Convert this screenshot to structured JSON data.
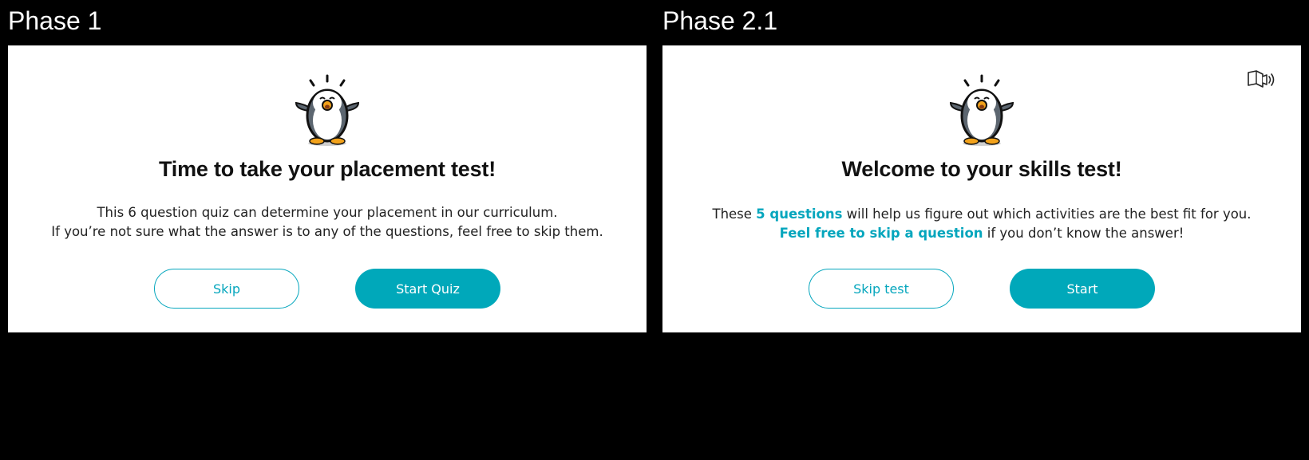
{
  "phase1": {
    "label": "Phase 1",
    "title": "Time to take your placement test!",
    "body_line1": "This 6 question quiz can determine your placement in our curriculum.",
    "body_line2": "If you’re not sure what the answer is to any of the questions, feel free to skip them.",
    "skip_label": "Skip",
    "start_label": "Start Quiz"
  },
  "phase2": {
    "label": "Phase 2.1",
    "title": "Welcome to your skills test!",
    "body_line1_pre": "These ",
    "body_line1_hl": "5 questions",
    "body_line1_post": " will help us figure out which activities are the best fit for you.",
    "body_line2_hl": "Feel free to skip a question",
    "body_line2_post": " if you don’t know the answer!",
    "skip_label": "Skip test",
    "start_label": "Start"
  },
  "icons": {
    "mascot": "penguin-mascot-icon",
    "audio": "speaker-icon"
  },
  "colors": {
    "accent": "#00a8ba",
    "background": "#000000",
    "panel": "#ffffff"
  }
}
